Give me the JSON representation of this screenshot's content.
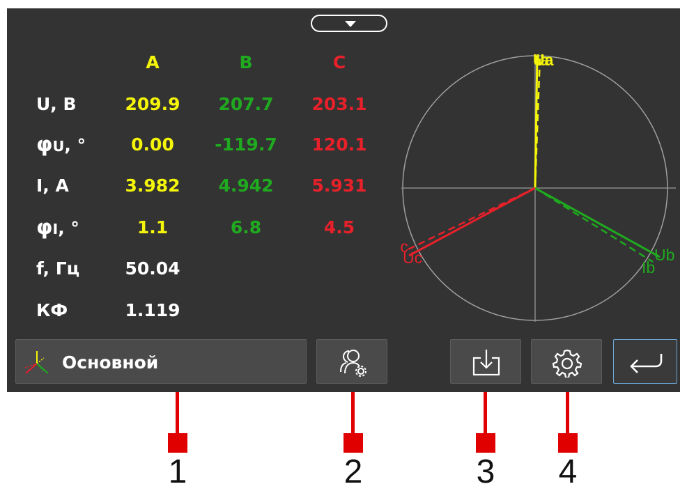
{
  "colors": {
    "phase_a": "#f5f50a",
    "phase_b": "#1faa1f",
    "phase_c": "#e8202a",
    "background": "#333333"
  },
  "table": {
    "headers": [
      "A",
      "B",
      "C"
    ],
    "rows": [
      {
        "label": "U, В",
        "values": [
          "209.9",
          "207.7",
          "203.1"
        ]
      },
      {
        "label_main": "φ",
        "label_sub": "U",
        "label_unit": ", °",
        "values": [
          "0.00",
          "-119.7",
          "120.1"
        ]
      },
      {
        "label": "I, A",
        "values": [
          "3.982",
          "4.942",
          "5.931"
        ]
      },
      {
        "label_main": "φ",
        "label_sub": "I",
        "label_unit": ", °",
        "values": [
          "1.1",
          "6.8",
          "4.5"
        ]
      },
      {
        "label": "f, Гц",
        "values": [
          "50.04"
        ]
      },
      {
        "label": "КФ",
        "values": [
          "1.119"
        ]
      }
    ]
  },
  "vector_diagram": {
    "labels": {
      "ua": "Ua",
      "ia": "Ia",
      "ub": "Ub",
      "ib": "Ib",
      "uc": "Uc",
      "ic": "Ic"
    }
  },
  "buttons": {
    "mode_label": "Основной",
    "mode_icon": "phase-axes-icon",
    "profile_icon": "users-settings-icon",
    "download_icon": "download-icon",
    "settings_icon": "gear-icon",
    "back_icon": "return-arrow-icon",
    "dropdown_icon": "chevron-down-icon"
  },
  "callouts": [
    "1",
    "2",
    "3",
    "4"
  ]
}
